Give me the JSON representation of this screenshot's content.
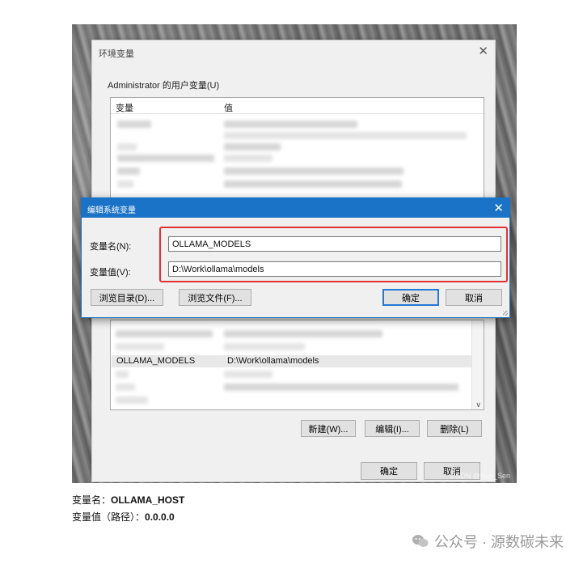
{
  "env_dialog": {
    "title": "环境变量",
    "user_group_label": "Administrator 的用户变量(U)",
    "columns": {
      "name": "变量",
      "value": "值"
    },
    "system_list": {
      "visible_row": {
        "name": "OLLAMA_MODELS",
        "value": "D:\\Work\\ollama\\models"
      }
    },
    "buttons": {
      "new": "新建(W)...",
      "edit": "编辑(I)...",
      "delete": "删除(L)"
    },
    "ok": "确定",
    "cancel": "取消",
    "watermark": "CSDN @Sun_Sen"
  },
  "edit_dialog": {
    "title": "编辑系统变量",
    "name_label": "变量名(N):",
    "value_label": "变量值(V):",
    "name_value": "OLLAMA_MODELS",
    "value_value": "D:\\Work\\ollama\\models",
    "browse_dir": "浏览目录(D)...",
    "browse_file": "浏览文件(F)...",
    "ok": "确定",
    "cancel": "取消"
  },
  "caption": {
    "line1_label": "变量名：",
    "line1_value": "OLLAMA_HOST",
    "line2_label": "变量值（路径）：",
    "line2_value": "0.0.0.0"
  },
  "footer_watermark": "公众号 · 源数碳未来",
  "colors": {
    "accent": "#1a73c6",
    "highlight": "#e03232"
  }
}
